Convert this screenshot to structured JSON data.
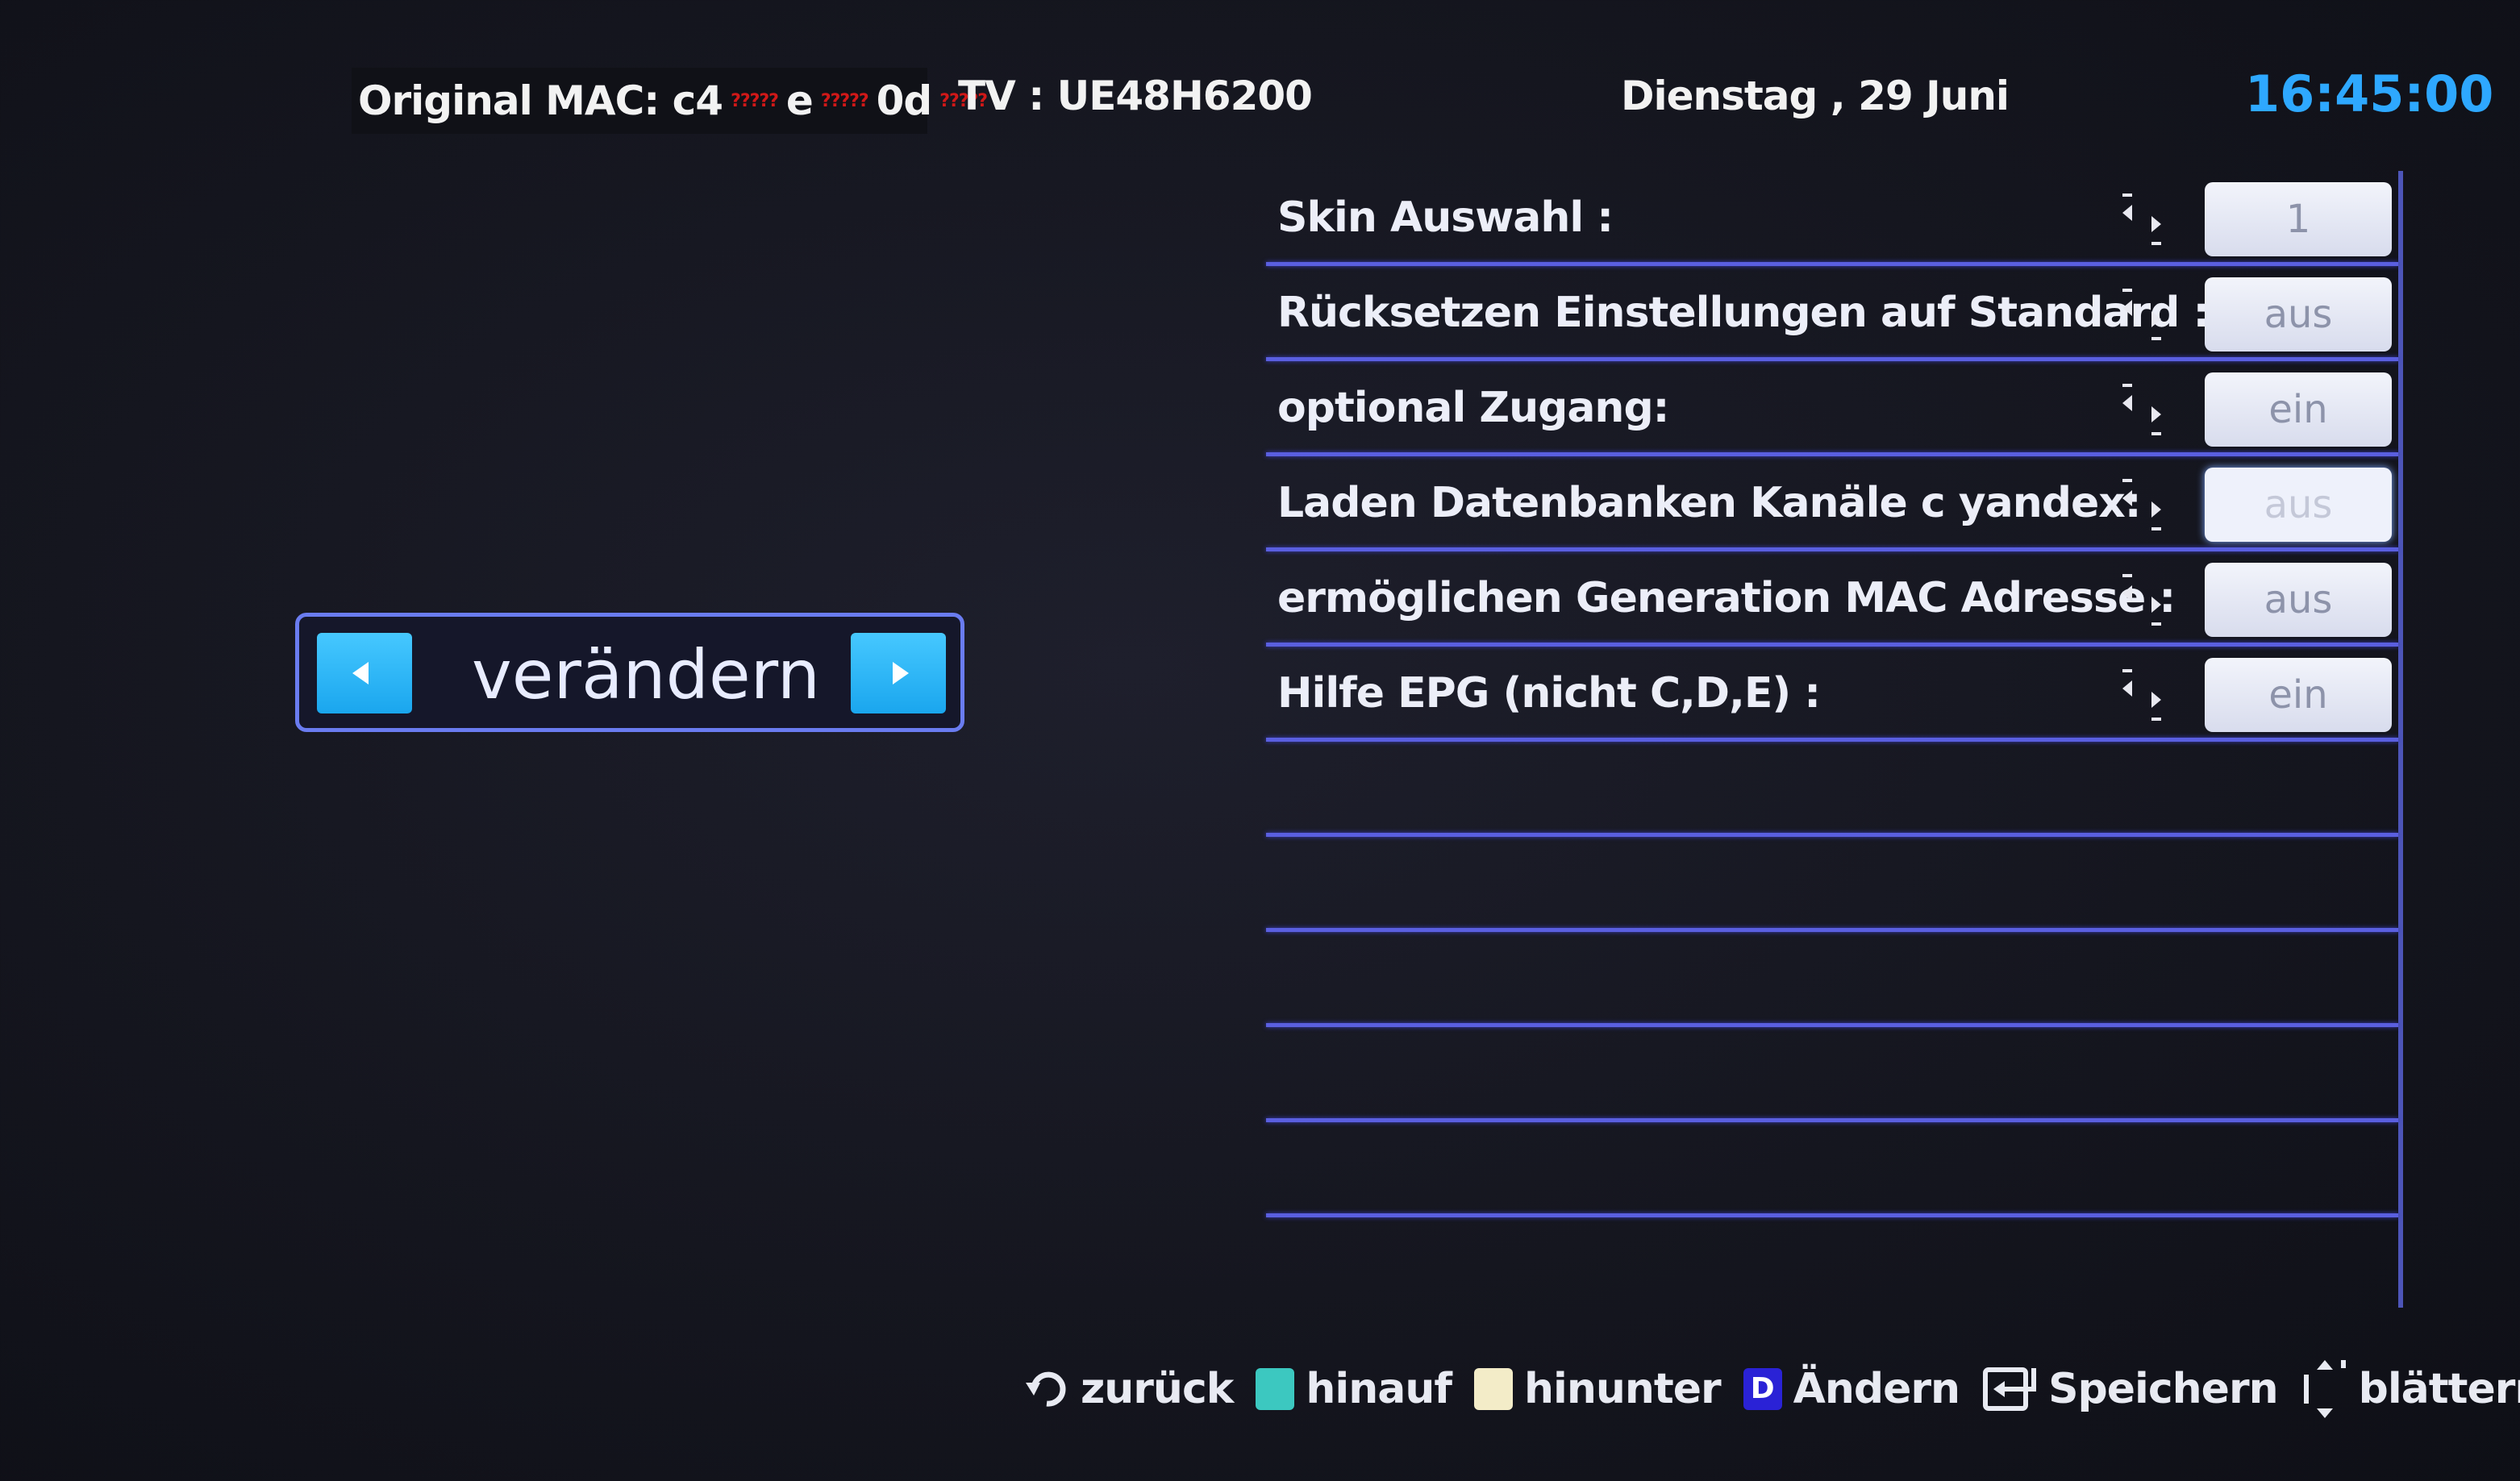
{
  "header": {
    "mac_label": "Original MAC: c4",
    "mac_part2": "e",
    "mac_part3": "0d",
    "redacted": "?????",
    "tv_model": "TV : UE48H6200",
    "date": "Dienstag , 29 Juni",
    "time": "16:45:00"
  },
  "changer": {
    "label": "verändern"
  },
  "settings": [
    {
      "label": "Skin  Auswahl :",
      "value": "1"
    },
    {
      "label": "Rücksetzen  Einstellungen  auf  Standard :",
      "value": "aus"
    },
    {
      "label": "optional  Zugang:",
      "value": "ein"
    },
    {
      "label": "Laden  Datenbanken  Kanäle  c yandex:",
      "value": "aus"
    },
    {
      "label": "ermöglichen  Generation  MAC  Adresse :",
      "value": "aus"
    },
    {
      "label": "Hilfe  EPG  (nicht C,D,E) :",
      "value": "ein"
    }
  ],
  "footer": {
    "back": "zurück",
    "up": "hinauf",
    "down": "hinunter",
    "change_key": "D",
    "change": "Ändern",
    "save": "Speichern",
    "scroll": "blättern"
  },
  "colors": {
    "clock": "#2ea8ff",
    "divider": "#5a5fe0",
    "arrow_button": "#1aa6ee",
    "green_key": "#3cc8c0",
    "yellow_key": "#f3ecc8",
    "blue_key": "#2a22d6"
  }
}
